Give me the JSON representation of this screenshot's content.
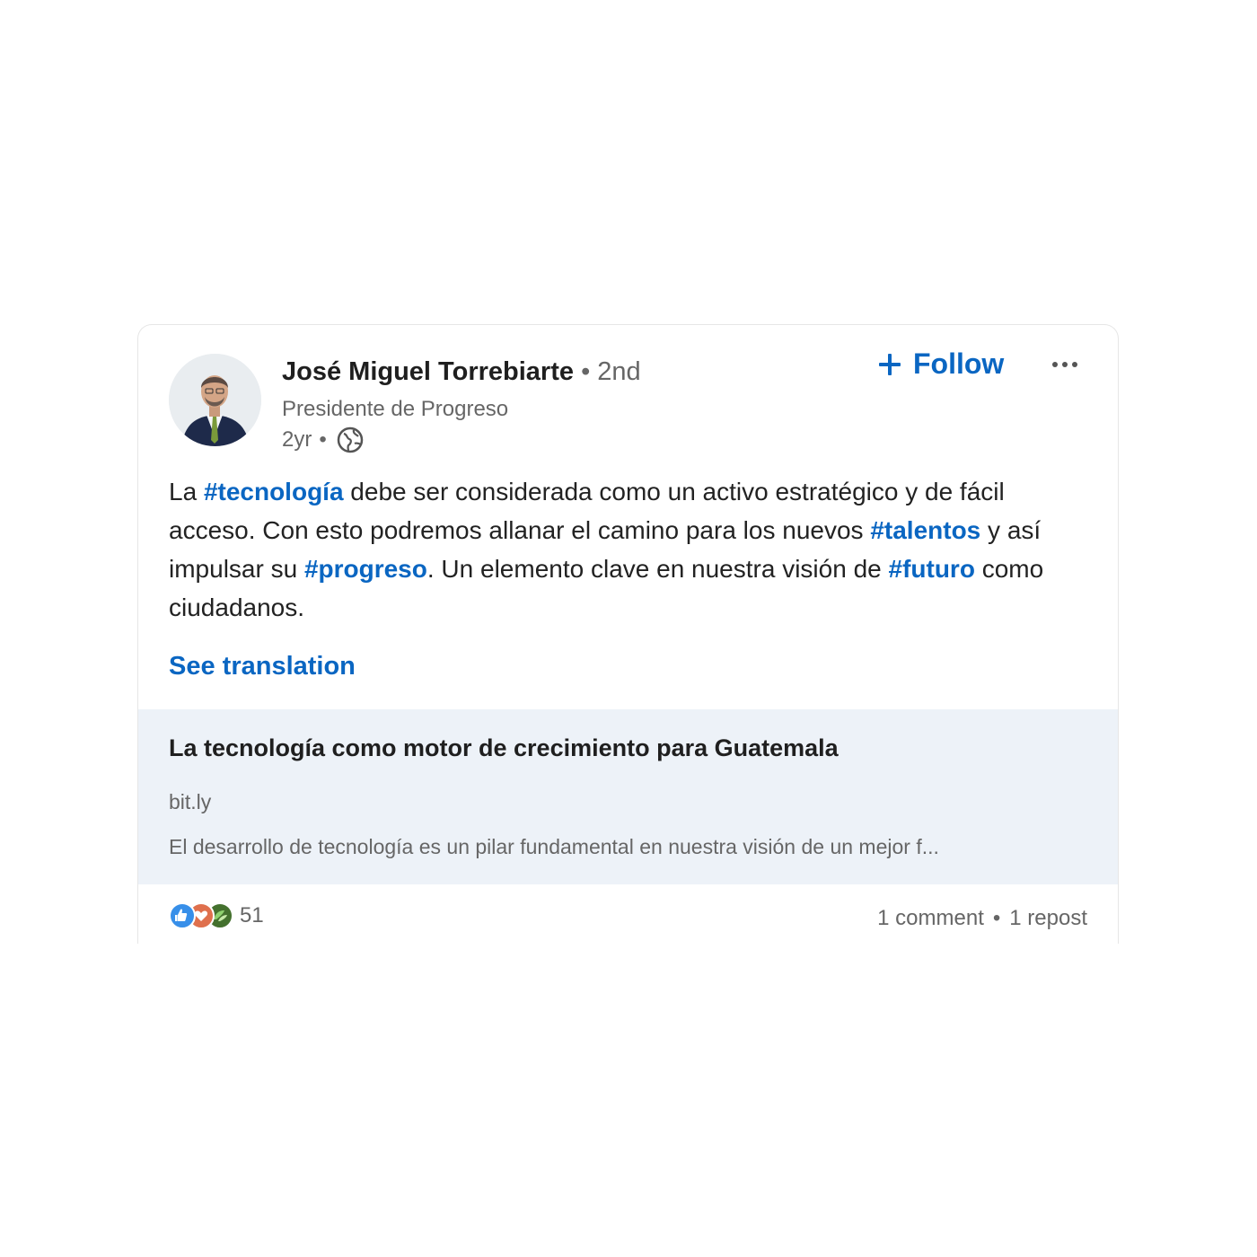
{
  "post": {
    "author": {
      "name": "José Miguel Torrebiarte",
      "degree": "• 2nd",
      "headline": "Presidente de Progreso",
      "time": "2yr",
      "time_separator": "•",
      "visibility_icon": "globe-icon"
    },
    "follow_label": "Follow",
    "more_icon": "ellipsis-icon",
    "body": {
      "t1": "La ",
      "h1": "#tecnología",
      "t2": " debe ser considerada como un activo estratégico y de fácil acceso. Con esto podremos allanar el camino para los nuevos ",
      "h2": "#talentos",
      "t3": " y así impulsar su ",
      "h3": "#progreso",
      "t4": ". Un elemento clave en nuestra visión de ",
      "h4": "#futuro",
      "t5": " como ciudadanos."
    },
    "see_translation": "See translation",
    "link_preview": {
      "title": "La tecnología como motor de crecimiento para Guatemala",
      "domain": "bit.ly",
      "description": "El desarrollo de tecnología es un pilar fundamental en nuestra visión de un mejor f..."
    },
    "social": {
      "reaction_icons": [
        "like-icon",
        "love-icon",
        "support-icon"
      ],
      "reaction_count": "51",
      "comments": "1 comment",
      "separator": "•",
      "reposts": "1 repost"
    },
    "colors": {
      "accent": "#0a66c2",
      "link_preview_bg": "#edf2f8",
      "secondary_text": "#666666"
    }
  }
}
